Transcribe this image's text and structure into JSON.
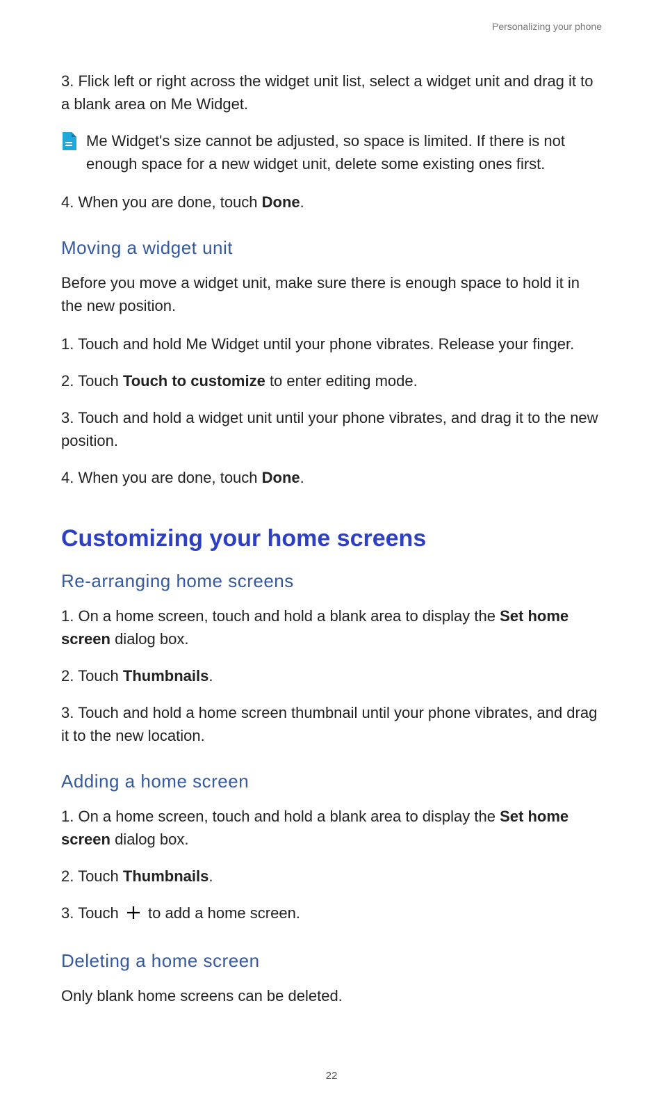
{
  "header": {
    "breadcrumb": "Personalizing your phone"
  },
  "intro_steps": {
    "s3": {
      "num": "3. ",
      "text": "Flick left or right across the widget unit list, select a widget unit and drag it to a blank area on Me Widget."
    },
    "note": "Me Widget's size cannot be adjusted, so space is limited. If there is not enough space for a new widget unit, delete some existing ones first.",
    "s4": {
      "num": "4. ",
      "pre": "When you are done, touch ",
      "bold": "Done",
      "post": "."
    }
  },
  "moving": {
    "heading": "Moving a widget unit",
    "intro": "Before you move a widget unit, make sure there is enough space to hold it in the new position.",
    "s1": {
      "num": "1. ",
      "text": "Touch and hold Me Widget until your phone vibrates. Release your finger."
    },
    "s2": {
      "num": "2. ",
      "pre": "Touch ",
      "bold": "Touch to customize",
      "post": " to enter editing mode."
    },
    "s3": {
      "num": "3. ",
      "text": "Touch and hold a widget unit until your phone vibrates, and drag it to the new position."
    },
    "s4": {
      "num": "4. ",
      "pre": "When you are done, touch ",
      "bold": "Done",
      "post": "."
    }
  },
  "custom_heading": "Customizing your home screens",
  "rearr": {
    "heading": "Re-arranging home screens",
    "s1": {
      "num": "1. ",
      "pre": "On a home screen, touch and hold a blank area to display the ",
      "bold": "Set home screen",
      "post": " dialog box."
    },
    "s2": {
      "num": "2. ",
      "pre": "Touch ",
      "bold": "Thumbnails",
      "post": "."
    },
    "s3": {
      "num": "3. ",
      "text": "Touch and hold a home screen thumbnail until your phone vibrates, and drag it to the new location."
    }
  },
  "adding": {
    "heading": "Adding a home screen",
    "s1": {
      "num": "1. ",
      "pre": "On a home screen, touch and hold a blank area to display the ",
      "bold": "Set home screen",
      "post": " dialog box."
    },
    "s2": {
      "num": "2. ",
      "pre": "Touch ",
      "bold": "Thumbnails",
      "post": "."
    },
    "s3": {
      "num": "3. ",
      "pre": "Touch ",
      "post": " to add a home screen."
    }
  },
  "deleting": {
    "heading": "Deleting a home screen",
    "text": "Only blank home screens can be deleted."
  },
  "page_number": "22"
}
